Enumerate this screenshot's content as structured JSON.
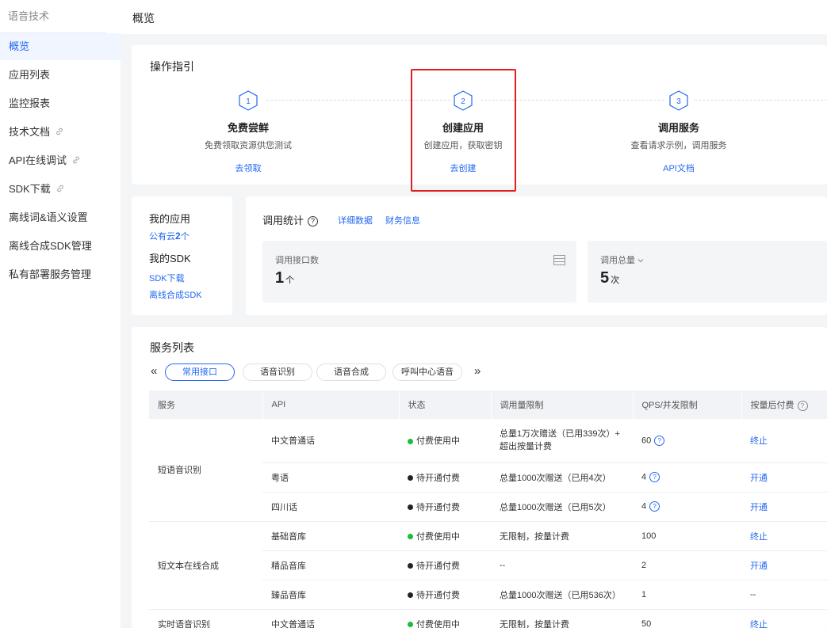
{
  "sidebar": {
    "title": "语音技术",
    "items": [
      {
        "label": "概览"
      },
      {
        "label": "应用列表"
      },
      {
        "label": "监控报表"
      },
      {
        "label": "技术文档"
      },
      {
        "label": "API在线调试"
      },
      {
        "label": "SDK下载"
      },
      {
        "label": "离线词&语义设置"
      },
      {
        "label": "离线合成SDK管理"
      },
      {
        "label": "私有部署服务管理"
      }
    ]
  },
  "header": {
    "title": "概览"
  },
  "guide": {
    "title": "操作指引",
    "steps": [
      {
        "num": "1",
        "name": "免费尝鲜",
        "desc": "免费领取资源供您测试",
        "link": "去领取"
      },
      {
        "num": "2",
        "name": "创建应用",
        "desc": "创建应用，获取密钥",
        "link": "去创建"
      },
      {
        "num": "3",
        "name": "调用服务",
        "desc": "查看请求示例，调用服务",
        "link": "API文档"
      }
    ]
  },
  "my": {
    "apps_title": "我的应用",
    "apps_prefix": "公有云",
    "apps_count": "2",
    "apps_suffix": "个",
    "sdk_title": "我的SDK",
    "sdk_download": "SDK下载",
    "offline_sdk": "离线合成SDK"
  },
  "stats": {
    "title": "调用统计",
    "tabs": [
      "详细数据",
      "财务信息"
    ],
    "boxes": [
      {
        "label": "调用接口数",
        "value": "1",
        "unit": "个"
      },
      {
        "label": "调用总量",
        "value": "5",
        "unit": "次"
      }
    ]
  },
  "services": {
    "title": "服务列表",
    "prev": "«",
    "next": "»",
    "tabs": [
      "常用接口",
      "语音识别",
      "语音合成",
      "呼叫中心语音"
    ],
    "columns": [
      "服务",
      "API",
      "状态",
      "调用量限制",
      "QPS/并发限制",
      "按量后付费"
    ],
    "groups": [
      {
        "name": "短语音识别",
        "rows": [
          {
            "api": "中文普通话",
            "status": "付费使用中",
            "limit": "总量1万次赠送（已用339次）+ 超出按量计费",
            "qps": "60",
            "action": "终止"
          },
          {
            "api": "粤语",
            "status": "待开通付费",
            "limit": "总量1000次赠送（已用4次）",
            "qps": "4",
            "action": "开通"
          },
          {
            "api": "四川话",
            "status": "待开通付费",
            "limit": "总量1000次赠送（已用5次）",
            "qps": "4",
            "action": "开通"
          }
        ]
      },
      {
        "name": "短文本在线合成",
        "rows": [
          {
            "api": "基础音库",
            "status": "付费使用中",
            "limit": "无限制，按量计费",
            "qps": "100",
            "action": "终止"
          },
          {
            "api": "精品音库",
            "status": "待开通付费",
            "limit": "--",
            "qps": "2",
            "action": "开通"
          },
          {
            "api": "臻品音库",
            "status": "待开通付费",
            "limit": "总量1000次赠送（已用536次）",
            "qps": "1",
            "action": "--"
          }
        ]
      },
      {
        "name": "实时语音识别",
        "rows": [
          {
            "api": "中文普通话",
            "status": "付费使用中",
            "limit": "无限制，按量计费",
            "qps": "50",
            "action": "终止"
          }
        ]
      }
    ]
  },
  "colors": {
    "accent": "#2468f2",
    "active_status": "#19be3c",
    "pending_status": "#222222",
    "highlight": "#e02020"
  }
}
